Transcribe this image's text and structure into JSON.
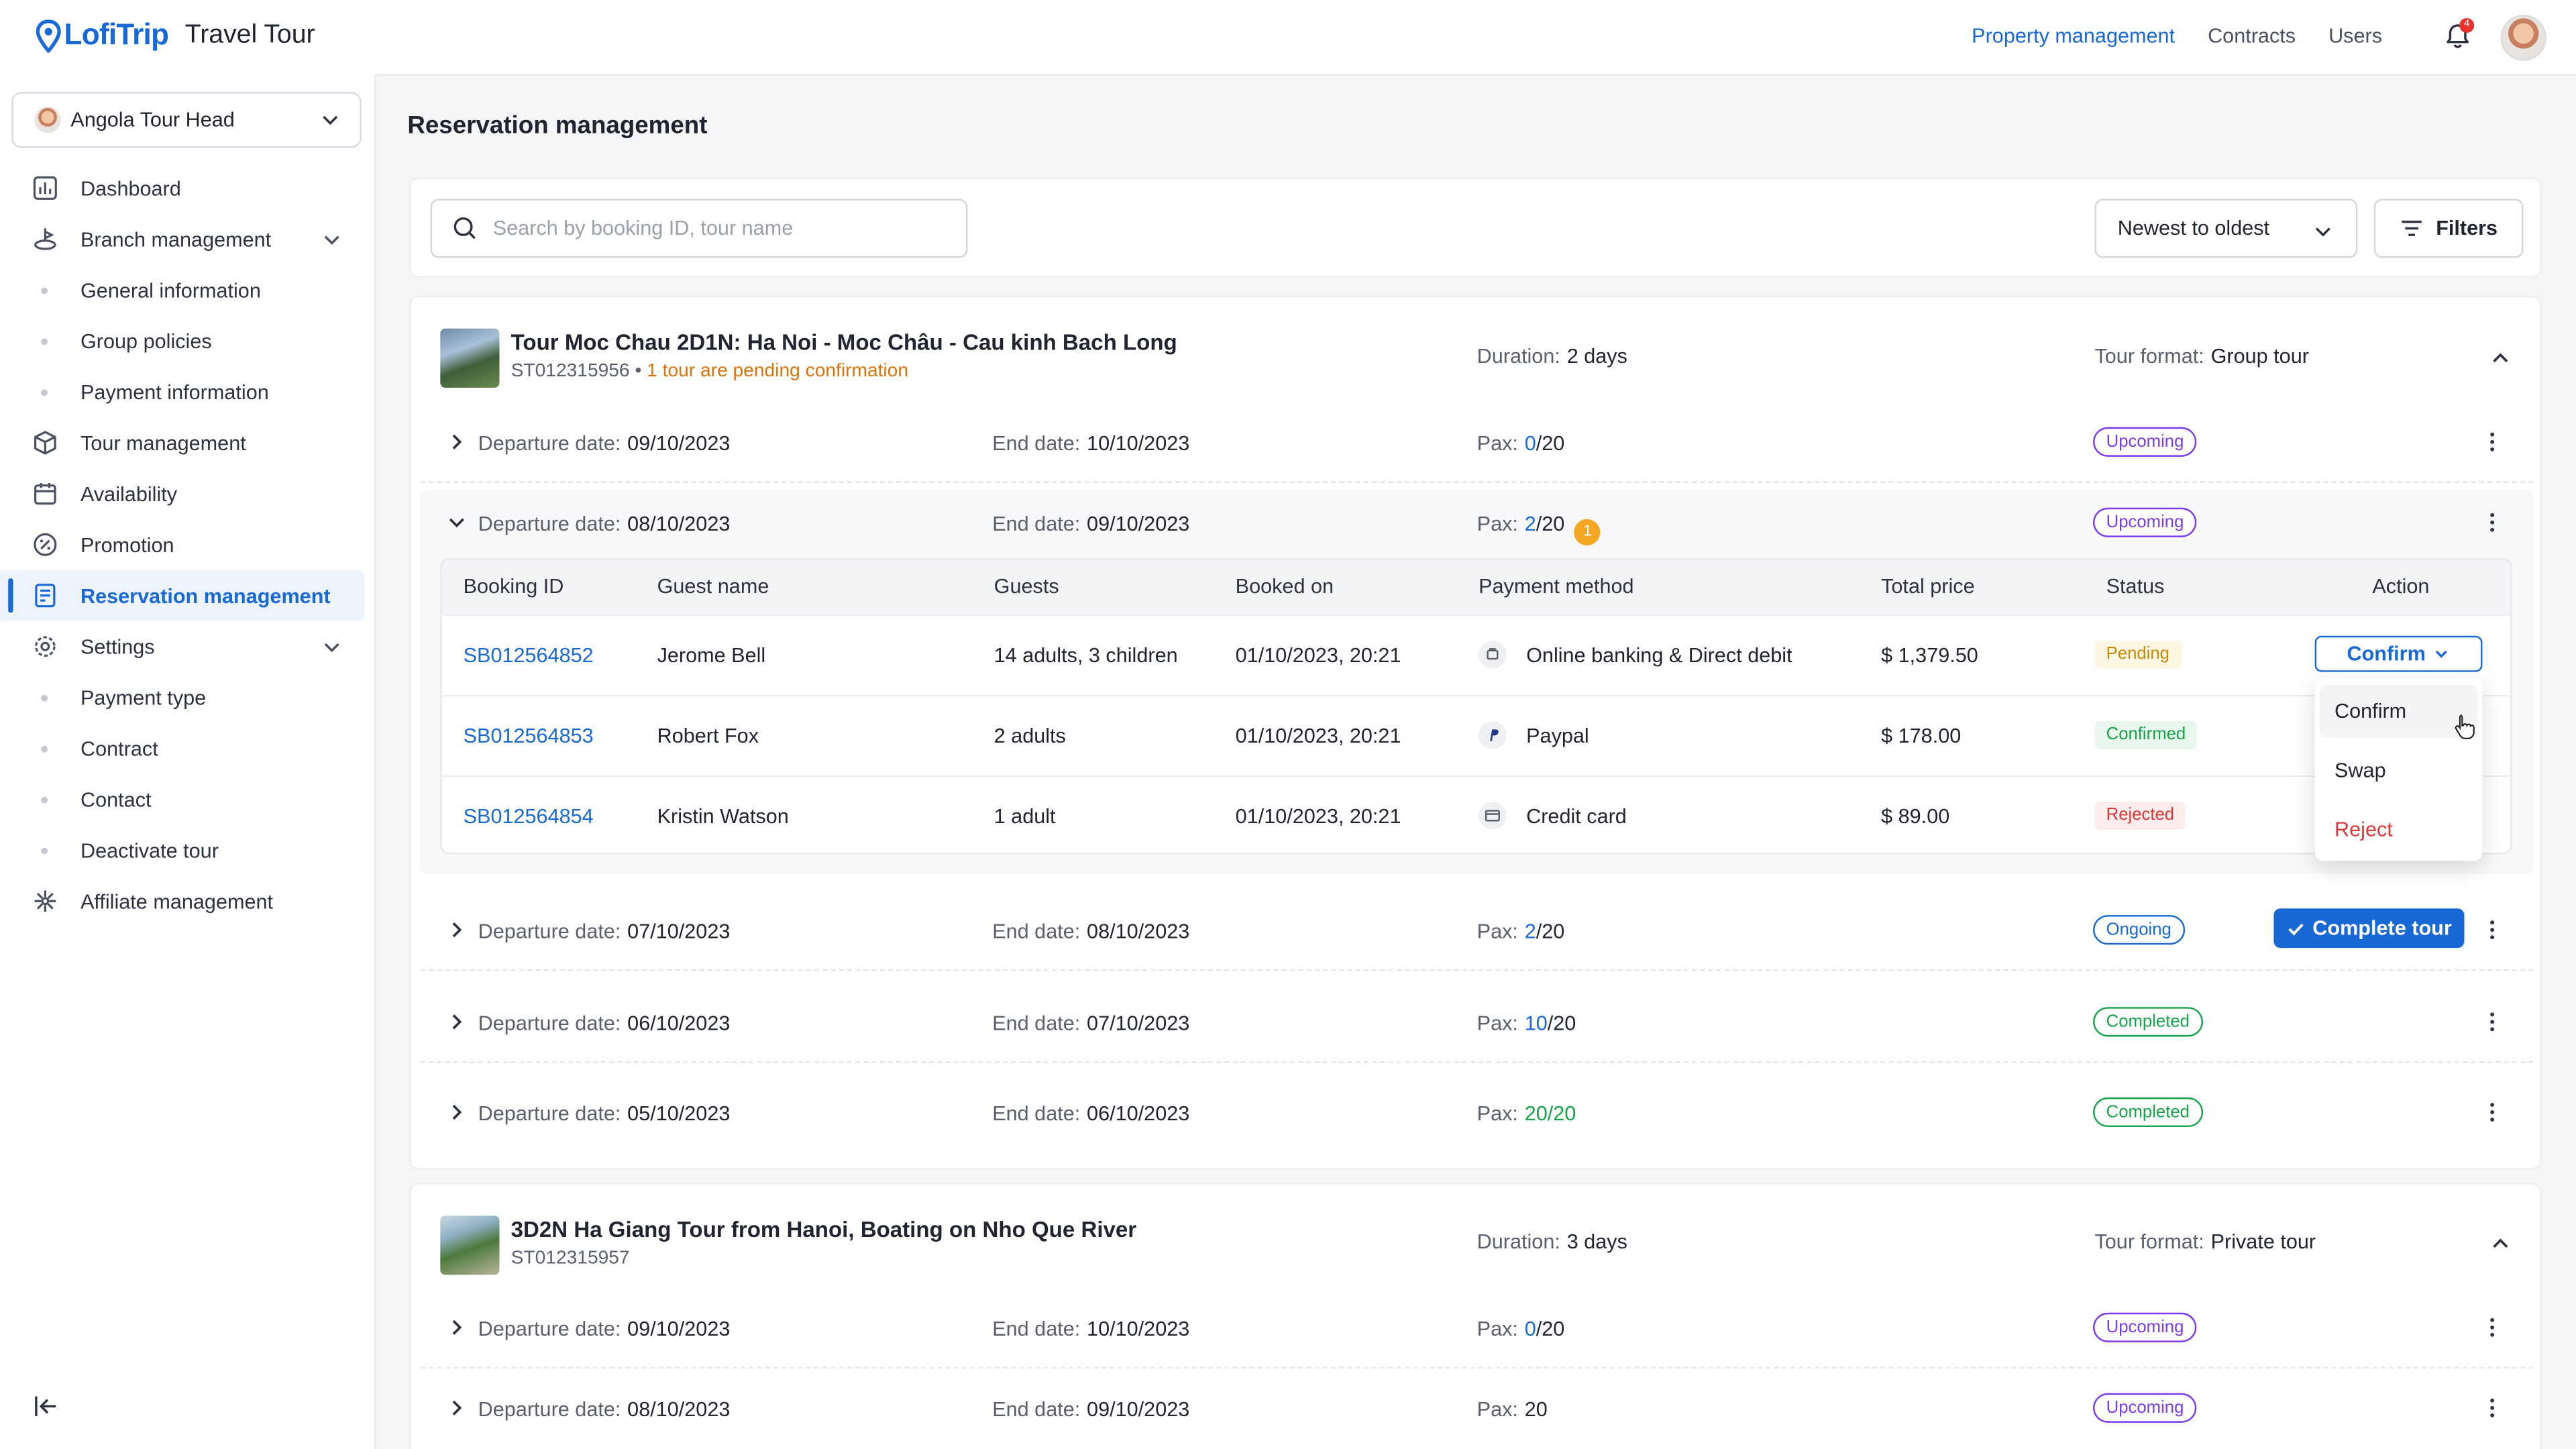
{
  "header": {
    "brand": "LofiTrip",
    "app_name": "Travel Tour",
    "nav": [
      "Property management",
      "Contracts",
      "Users"
    ],
    "notifications_count": "4"
  },
  "sidebar": {
    "org_name": "Angola Tour Head",
    "items": [
      {
        "label": "Dashboard",
        "icon": "dashboard-icon"
      },
      {
        "label": "Branch management",
        "icon": "branch-icon"
      },
      {
        "label": "General information"
      },
      {
        "label": "Group policies"
      },
      {
        "label": "Payment information"
      },
      {
        "label": "Tour management",
        "icon": "box-icon"
      },
      {
        "label": "Availability",
        "icon": "calendar-icon"
      },
      {
        "label": "Promotion",
        "icon": "percent-icon"
      },
      {
        "label": "Reservation management",
        "icon": "reservation-icon"
      },
      {
        "label": "Settings",
        "icon": "gear-icon"
      },
      {
        "label": "Payment type"
      },
      {
        "label": "Contract"
      },
      {
        "label": "Contact"
      },
      {
        "label": "Deactivate tour"
      },
      {
        "label": "Affiliate management",
        "icon": "affiliate-icon"
      }
    ]
  },
  "main": {
    "title": "Reservation management",
    "search_placeholder": "Search by booking ID, tour name",
    "sort_value": "Newest to oldest",
    "filters_label": "Filters"
  },
  "labels": {
    "departure": "Departure date:",
    "end": "End date:",
    "pax": "Pax:",
    "duration": "Duration:",
    "tour_format": "Tour format:"
  },
  "tours": [
    {
      "title": "Tour Moc Chau 2D1N: Ha Noi - Moc Châu - Cau kinh Bach Long",
      "code": "ST012315956",
      "separator": "•",
      "pending_note": "1 tour are pending confirmation",
      "duration": "2 days",
      "format": "Group tour",
      "departures": [
        {
          "dep": "09/10/2023",
          "end": "10/10/2023",
          "pax_booked": "0",
          "pax_total": "/20",
          "status": "Upcoming"
        },
        {
          "dep": "08/10/2023",
          "end": "09/10/2023",
          "pax_booked": "2",
          "pax_total": "/20",
          "pending_badge": "1",
          "status": "Upcoming"
        },
        {
          "dep": "07/10/2023",
          "end": "08/10/2023",
          "pax_booked": "2",
          "pax_total": "/20",
          "status": "Ongoing",
          "action": "Complete tour"
        },
        {
          "dep": "06/10/2023",
          "end": "07/10/2023",
          "pax_booked": "10",
          "pax_total": "/20",
          "status": "Completed"
        },
        {
          "dep": "05/10/2023",
          "end": "06/10/2023",
          "pax_booked": "20/20",
          "pax_total": "",
          "status": "Completed"
        }
      ]
    },
    {
      "title": "3D2N Ha Giang Tour from Hanoi, Boating on Nho Que River",
      "code": "ST012315957",
      "duration": "3 days",
      "format": "Private tour",
      "departures": [
        {
          "dep": "09/10/2023",
          "end": "10/10/2023",
          "pax_booked": "0",
          "pax_total": "/20",
          "status": "Upcoming"
        },
        {
          "dep": "08/10/2023",
          "end": "09/10/2023",
          "pax_booked": "",
          "pax_total": "20",
          "status": "Upcoming"
        }
      ]
    }
  ],
  "bookings": {
    "columns": [
      "Booking ID",
      "Guest name",
      "Guests",
      "Booked on",
      "Payment method",
      "Total price",
      "Status",
      "Action"
    ],
    "rows": [
      {
        "id": "SB012564852",
        "guest": "Jerome Bell",
        "guests": "14 adults, 3 children",
        "booked_on": "01/10/2023, 20:21",
        "payment": "Online banking & Direct debit",
        "total": "$ 1,379.50",
        "status": "Pending"
      },
      {
        "id": "SB012564853",
        "guest": "Robert Fox",
        "guests": "2 adults",
        "booked_on": "01/10/2023, 20:21",
        "payment": "Paypal",
        "total": "$ 178.00",
        "status": "Confirmed"
      },
      {
        "id": "SB012564854",
        "guest": "Kristin Watson",
        "guests": "1 adult",
        "booked_on": "01/10/2023, 20:21",
        "payment": "Credit card",
        "total": "$ 89.00",
        "status": "Rejected"
      }
    ],
    "action_button": "Confirm",
    "action_menu": [
      "Confirm",
      "Swap",
      "Reject"
    ]
  },
  "colors": {
    "accent": "#1868d6",
    "upcoming": "#7c3aed",
    "completed": "#16a34a",
    "pending": "#d9740b",
    "danger": "#d93838"
  }
}
